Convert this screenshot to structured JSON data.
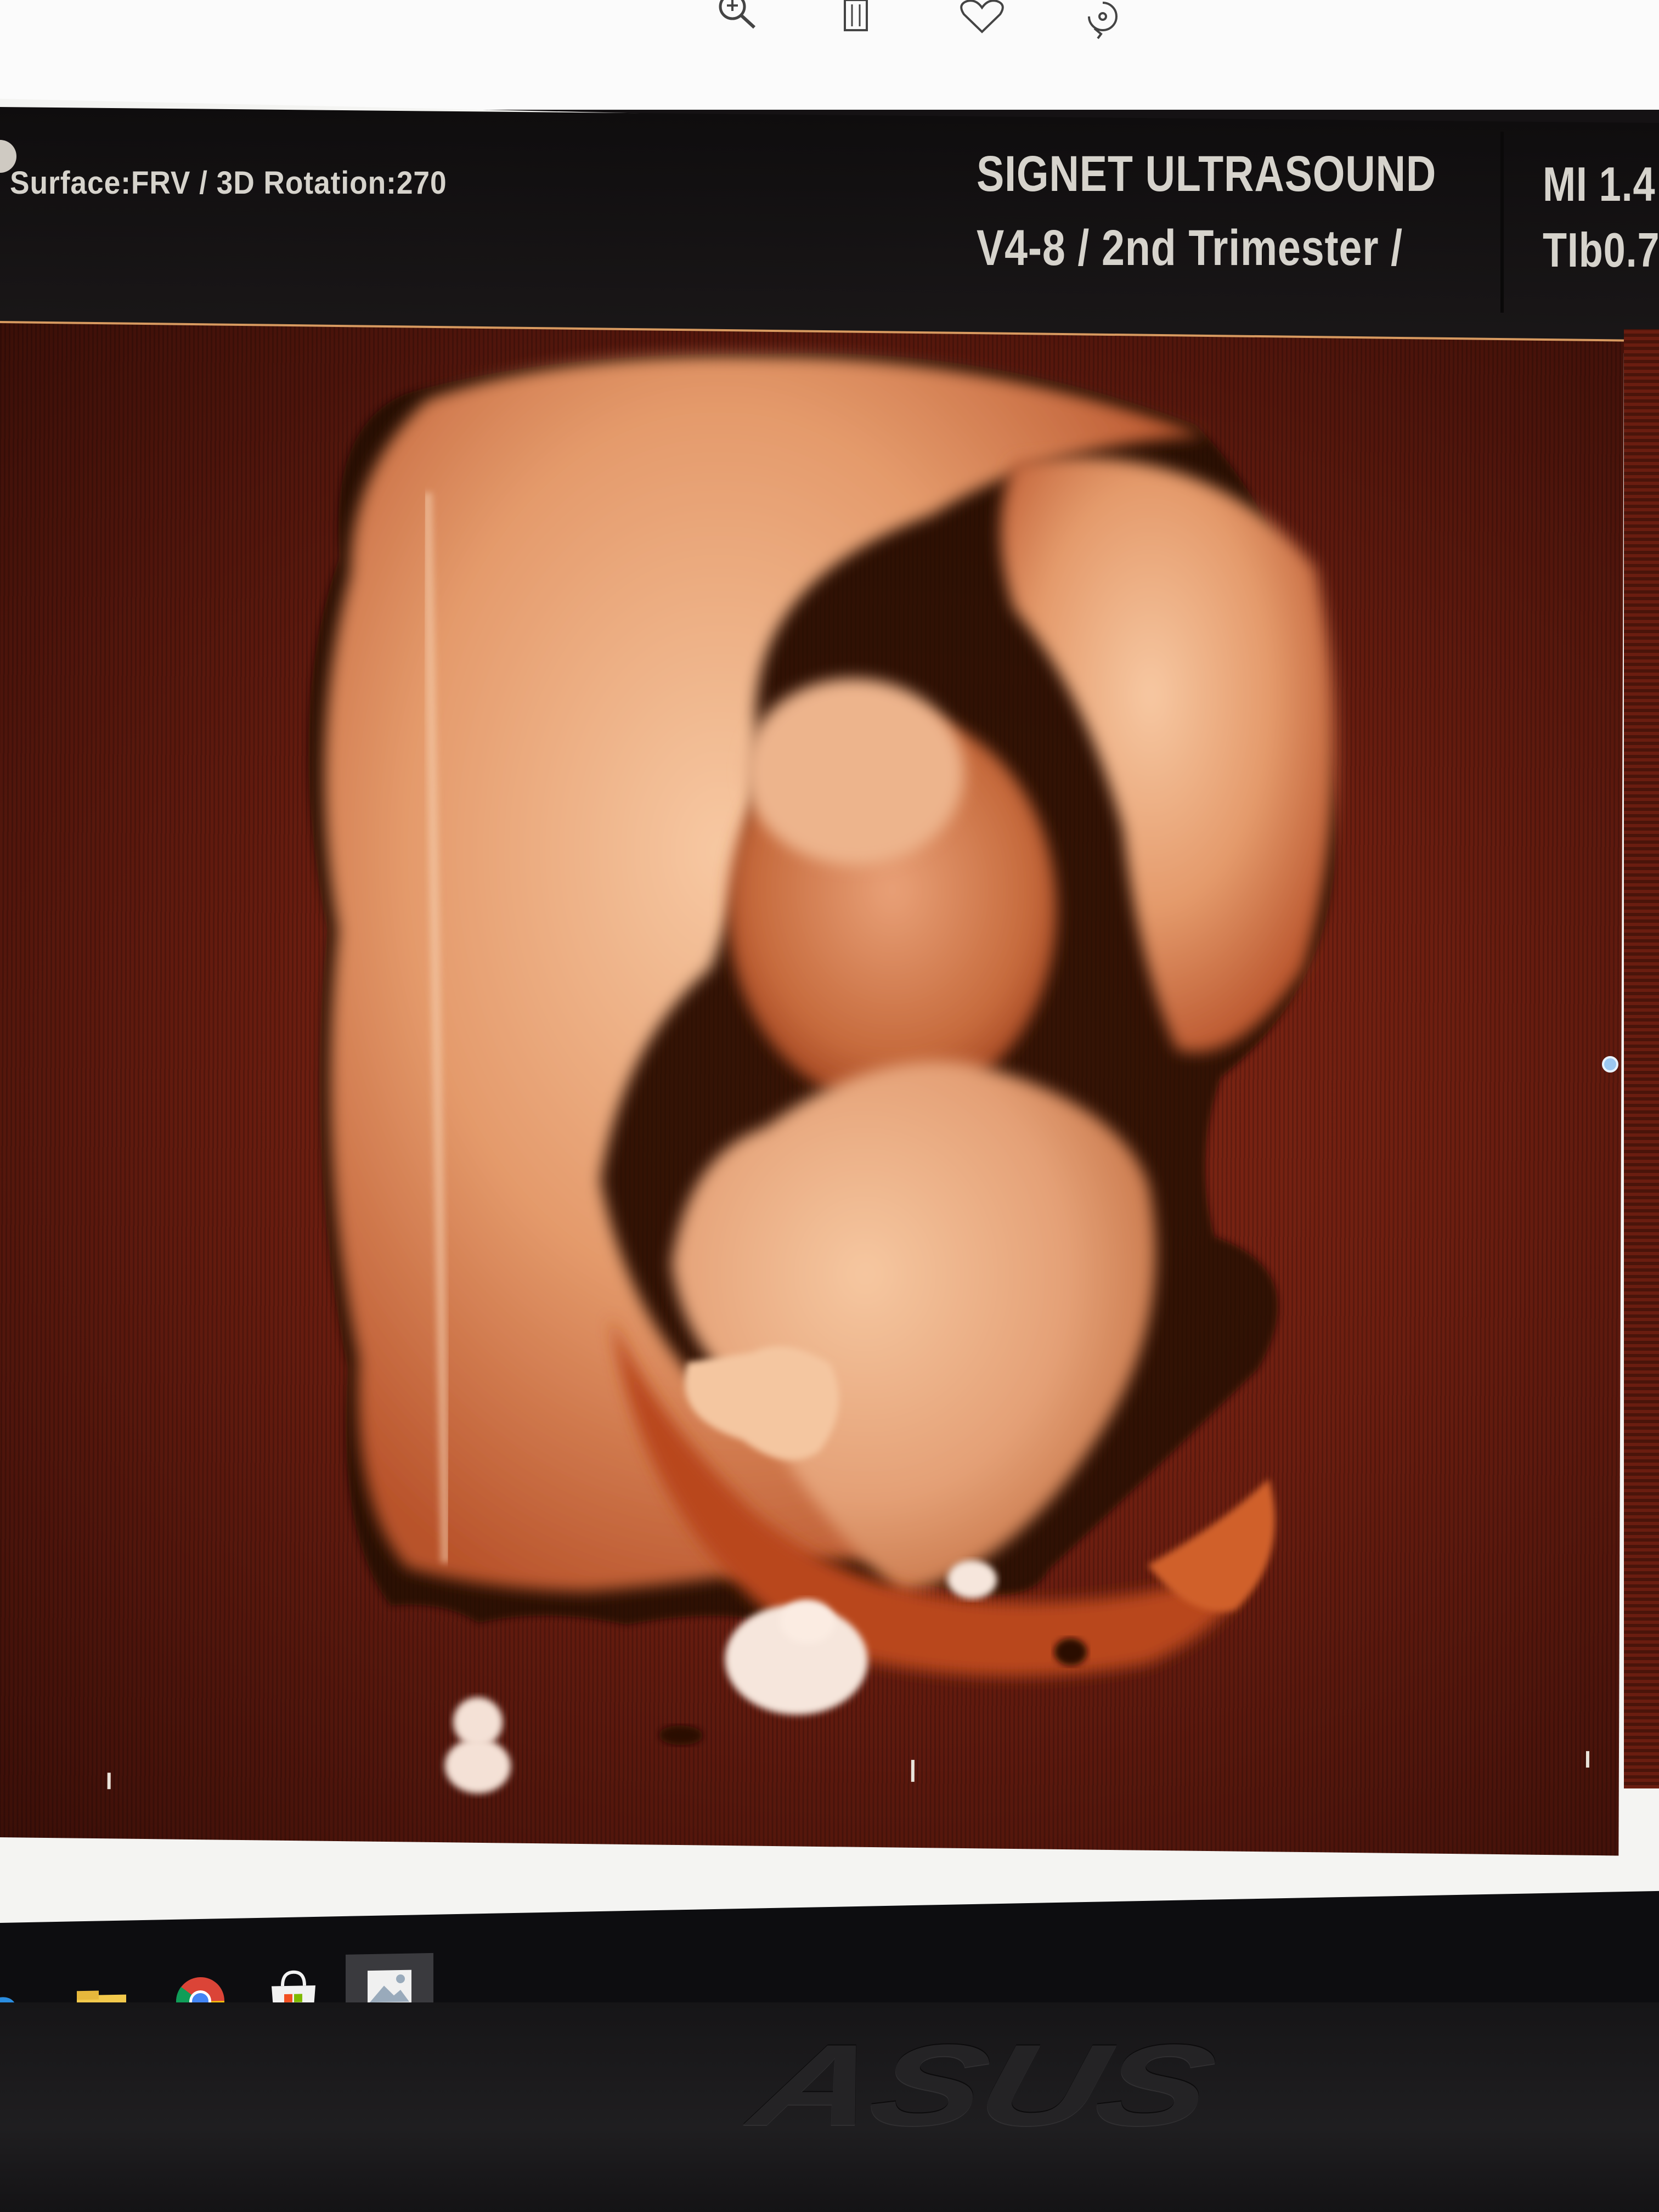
{
  "toolbar": {
    "icons": [
      "zoom-in-icon",
      "delete-icon",
      "heart-icon",
      "rotate-icon"
    ]
  },
  "ultrasound": {
    "surface_info": "Surface:FRV / 3D Rotation:270",
    "device_name": "SIGNET ULTRASOUND",
    "preset": "V4-8 / 2nd Trimester /",
    "mi": "MI  1.4",
    "tib": "TIb0.7"
  },
  "taskbar": {
    "items": [
      "edge-icon",
      "file-explorer-icon",
      "chrome-icon",
      "store-icon",
      "photos-icon"
    ],
    "active_item": "photos-icon"
  },
  "bezel": {
    "brand": "ASUS"
  },
  "colors": {
    "volume_background": "#6d1e10",
    "tissue_light": "#f1b58c",
    "tissue_mid": "#d27a4a",
    "tissue_dark": "#a8401e"
  }
}
